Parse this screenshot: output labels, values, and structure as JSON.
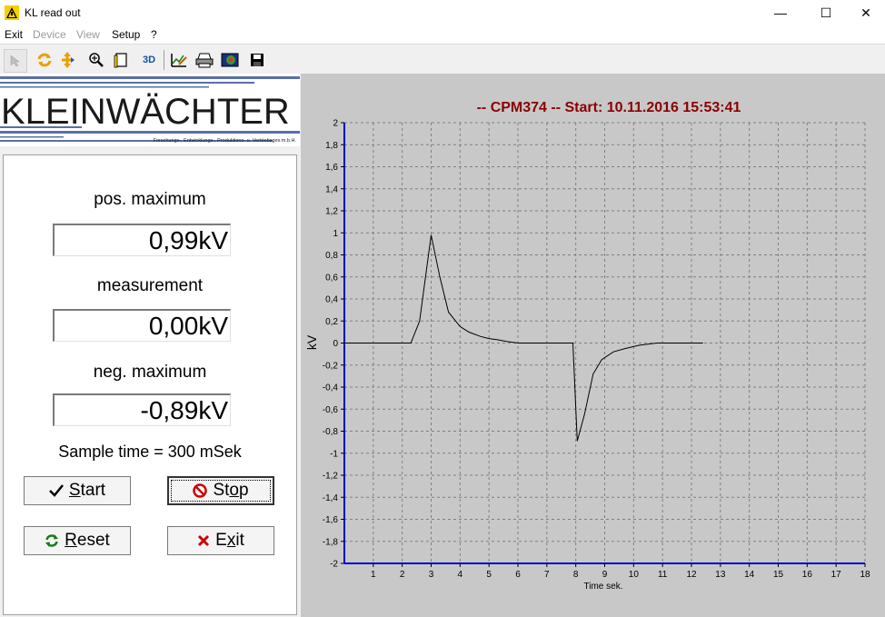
{
  "window": {
    "title": "KL read out",
    "minimize_glyph": "—",
    "maximize_glyph": "☐",
    "close_glyph": "✕"
  },
  "menu": {
    "items": [
      {
        "label": "Exit",
        "enabled": true
      },
      {
        "label": "Device",
        "enabled": false
      },
      {
        "label": "View",
        "enabled": false
      },
      {
        "label": "Setup",
        "enabled": true
      },
      {
        "label": "?",
        "enabled": true
      }
    ]
  },
  "toolbar": {
    "icons": [
      "pointer-icon",
      "refresh-icon",
      "move-icon",
      "zoom-icon",
      "page-icon",
      "3d-icon",
      "chart-edit-icon",
      "print-icon",
      "export-image-icon",
      "save-icon"
    ],
    "label_3d": "3D"
  },
  "logo": {
    "brand": "KLEINWÄCHTER",
    "tagline": "Forschungs-, Entwicklungs-, Produktions- u. Vertriebsges.m.b.H."
  },
  "panel": {
    "pos_max_label": "pos. maximum",
    "pos_max_value": "0,99kV",
    "measurement_label": "measurement",
    "measurement_value": "0,00kV",
    "neg_max_label": "neg. maximum",
    "neg_max_value": "-0,89kV",
    "sample_time": "Sample time = 300 mSek",
    "start_prefix": "",
    "start_ul": "S",
    "start_rest": "tart",
    "stop_pre": "St",
    "stop_ul": "o",
    "stop_rest": "p",
    "reset_ul": "R",
    "reset_rest": "eset",
    "exit_pre": "E",
    "exit_ul": "x",
    "exit_rest": "it"
  },
  "colors": {
    "title_red": "#8b0000",
    "axis_blue": "#0000cc",
    "logo_blue": "#5a6fa8"
  },
  "chart_data": {
    "type": "line",
    "title": "-- CPM374 -- Start: 10.11.2016 15:53:41",
    "xlabel": "Time sek.",
    "ylabel": "kV",
    "xlim": [
      0,
      18
    ],
    "ylim": [
      -2,
      2
    ],
    "x_ticks": [
      "1",
      "2",
      "3",
      "4",
      "5",
      "6",
      "7",
      "8",
      "9",
      "10",
      "11",
      "12",
      "13",
      "14",
      "15",
      "16",
      "17",
      "18"
    ],
    "y_ticks": [
      "2",
      "1,8",
      "1,6",
      "1,4",
      "1,2",
      "1",
      "0,8",
      "0,6",
      "0,4",
      "0,2",
      "0",
      "-0,2",
      "-0,4",
      "-0,6",
      "-0,8",
      "-1",
      "-1,2",
      "-1,4",
      "-1,6",
      "-1,8",
      "-2"
    ],
    "grid": true,
    "series": [
      {
        "x": [
          0,
          2.3,
          2.6,
          3.0,
          3.3,
          3.6,
          4.0,
          4.3,
          4.7,
          5.0,
          5.3,
          5.6,
          6.0,
          6.5,
          7.0,
          7.5,
          7.9,
          8.05,
          8.3,
          8.6,
          8.9,
          9.3,
          9.7,
          10.2,
          10.8,
          11.5,
          12.4
        ],
        "y": [
          0,
          0,
          0.2,
          0.98,
          0.6,
          0.28,
          0.15,
          0.1,
          0.06,
          0.04,
          0.03,
          0.015,
          0,
          0,
          0,
          0,
          0,
          -0.89,
          -0.65,
          -0.28,
          -0.15,
          -0.08,
          -0.05,
          -0.02,
          0,
          0,
          0
        ]
      }
    ]
  }
}
